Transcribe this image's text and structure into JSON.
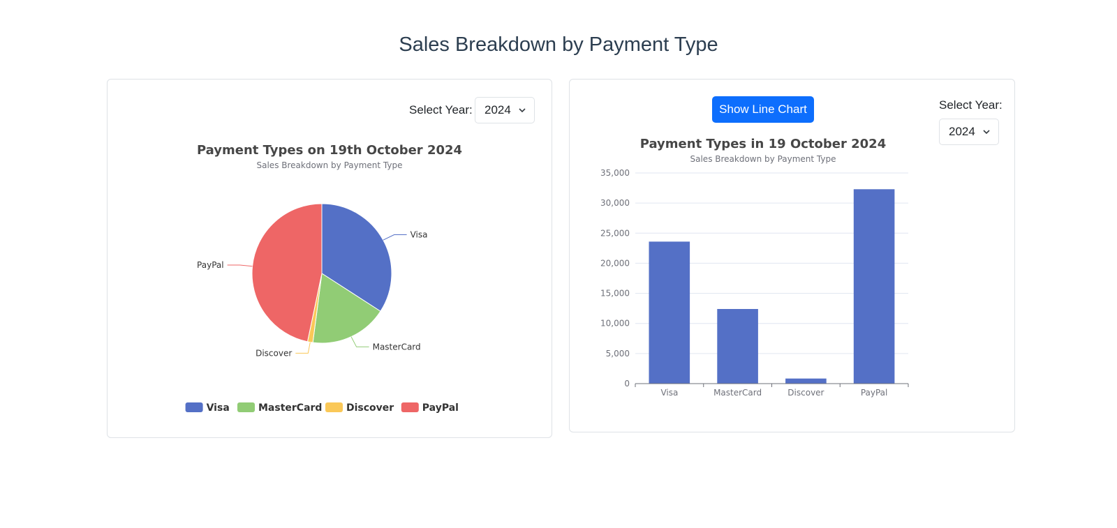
{
  "page": {
    "title": "Sales Breakdown by Payment Type"
  },
  "pie_card": {
    "year_label": "Select Year:",
    "year_value": "2024"
  },
  "bar_card": {
    "button_label": "Show Line Chart",
    "year_label": "Select Year:",
    "year_value": "2024"
  },
  "colors": {
    "visa": "#5470c6",
    "mastercard": "#91cc75",
    "discover": "#fac858",
    "paypal": "#ee6666",
    "accent": "#0d6efd"
  },
  "icons": {
    "dropdown": "chevron-down-icon"
  },
  "chart_data": [
    {
      "type": "pie",
      "title": "Payment Types on 19th October 2024",
      "subtitle": "Sales Breakdown by Payment Type",
      "categories": [
        "Visa",
        "MasterCard",
        "Discover",
        "PayPal"
      ],
      "values": [
        23600,
        12400,
        850,
        32300
      ],
      "colors": [
        "#5470c6",
        "#91cc75",
        "#fac858",
        "#ee6666"
      ],
      "legend": [
        "Visa",
        "MasterCard",
        "Discover",
        "PayPal"
      ],
      "legend_position": "bottom"
    },
    {
      "type": "bar",
      "title": "Payment Types in 19 October 2024",
      "subtitle": "Sales Breakdown by Payment Type",
      "categories": [
        "Visa",
        "MasterCard",
        "Discover",
        "PayPal"
      ],
      "values": [
        23600,
        12400,
        850,
        32300
      ],
      "ylim": [
        0,
        35000
      ],
      "yticks": [
        "0",
        "5,000",
        "10,000",
        "15,000",
        "20,000",
        "25,000",
        "30,000",
        "35,000"
      ],
      "color": "#5470c6",
      "grid": true
    }
  ]
}
